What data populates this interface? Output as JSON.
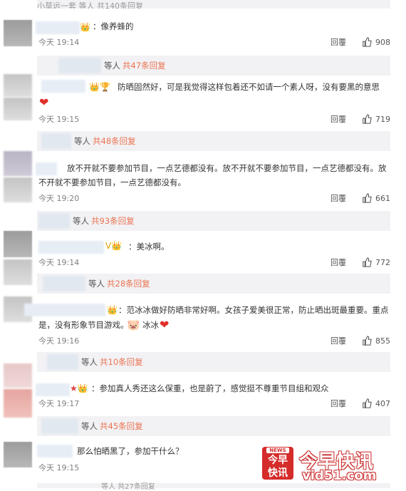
{
  "top_strip": {
    "text": "小草远一套 等人 共140条回复"
  },
  "comments": [
    {
      "text": "：像养蜂的",
      "time": "今天 19:14",
      "likes": "908",
      "reply_label": "回覆",
      "sub": {
        "people": "等人",
        "count": "共47条回复"
      }
    },
    {
      "text": "防晒固然好，可是我觉得这样包着还不如请一个素人呀，没有要黑的意思",
      "time": "今天 19:15",
      "likes": "719",
      "reply_label": "回覆",
      "sub": {
        "people": "等人",
        "count": "共48条回复"
      }
    },
    {
      "text_line1": "放不开就不要参加节目，一点艺德都没有。放不开就不要参加节目，一点艺德都没有。放",
      "text_line2": "不开就不要参加节目，一点艺德都没有。",
      "time": "今天 19:20",
      "likes": "661",
      "reply_label": "回覆",
      "sub": {
        "people": "等人",
        "count": "共93条回复"
      }
    },
    {
      "text": "：美冰啊。",
      "time": "今天 19:14",
      "likes": "772",
      "reply_label": "回覆",
      "sub": {
        "people": "等人",
        "count": "共28条回复"
      }
    },
    {
      "text_line1": "：范冰冰做好防晒非常好啊。女孩子爱美很正常，防止晒出斑最重要。重点",
      "text_line2": "是，没有形象节目游戏。",
      "text_tail": "冰冰",
      "time": "今天 19:16",
      "likes": "855",
      "reply_label": "回覆",
      "sub": {
        "people": "等人",
        "count": "共10条回复"
      }
    },
    {
      "text": "：参加真人秀还这么保重，也是蔚了，感觉挺不尊重节目组和观众",
      "time": "今天 19:17",
      "likes": "407",
      "reply_label": "回覆",
      "sub": {
        "people": "等人",
        "count": "共45条回复"
      }
    },
    {
      "text": "那么怕晒黑了，参加干什么？",
      "time": "今天 19:15"
    }
  ],
  "bottom_strip": {
    "text": "等人 共27条回复"
  },
  "watermark": {
    "badge_top": "今早",
    "badge_bottom": "快讯",
    "title": "今早快讯",
    "url": "vid51.com",
    "news": "NEWS"
  },
  "icons": {
    "thumb": "thumbs-up-icon",
    "heart": "heart-icon"
  }
}
